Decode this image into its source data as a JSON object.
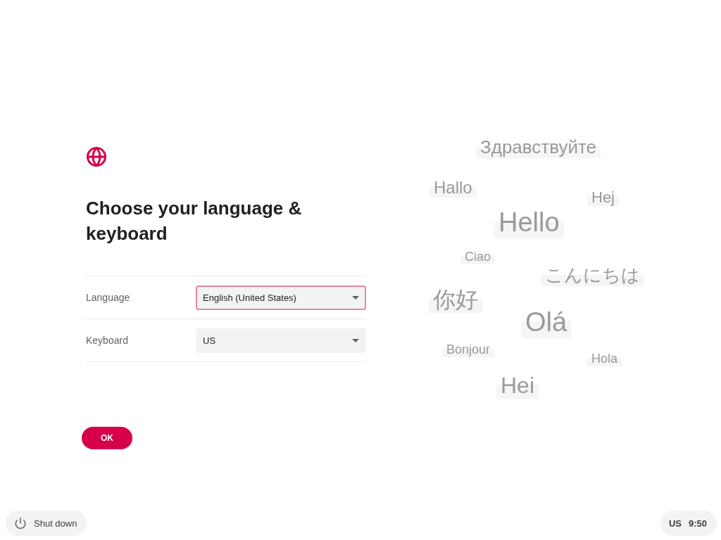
{
  "header": {
    "title": "Choose your language & keyboard"
  },
  "fields": [
    {
      "label": "Language",
      "value": "English (United States)",
      "focused": true
    },
    {
      "label": "Keyboard",
      "value": "US",
      "focused": false
    }
  ],
  "ok_button": "OK",
  "greetings": [
    "Здравствуйте",
    "Hallo",
    "Hej",
    "Hello",
    "Ciao",
    "こんにちは",
    "你好",
    "Olá",
    "Bonjour",
    "Hola",
    "Hei"
  ],
  "shelf": {
    "shutdown": "Shut down",
    "keyboard_layout": "US",
    "time": "9:50"
  }
}
